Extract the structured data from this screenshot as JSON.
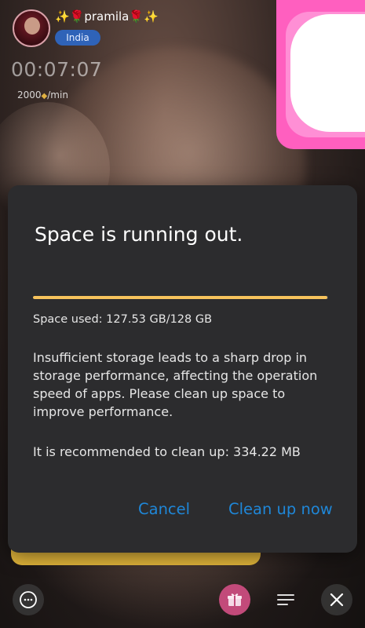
{
  "host": {
    "username": "✨🌹pramila🌹✨",
    "country": "India",
    "timer": "00:07:07",
    "rate_value": "2000",
    "rate_unit": "/min"
  },
  "dialog": {
    "title": "Space is running out.",
    "progress_fraction": 0.9963,
    "space_used": "Space used: 127.53 GB/128 GB",
    "description": "Insufficient storage leads to a sharp drop in storage performance, affecting the operation speed of apps. Please clean up space to improve performance.",
    "recommendation": "It is recommended to clean up: 334.22 MB",
    "cancel_label": "Cancel",
    "confirm_label": "Clean up now"
  },
  "bottom_bar": {
    "icons": [
      "chat-icon",
      "gift-icon",
      "menu-icon",
      "close-icon"
    ]
  },
  "colors": {
    "accent": "#1f87d8",
    "progress": "#f7c35c",
    "dialog_bg": "#2c2c2e",
    "country_badge": "#2f63b8",
    "pink_widget": "#ff5fbf"
  }
}
